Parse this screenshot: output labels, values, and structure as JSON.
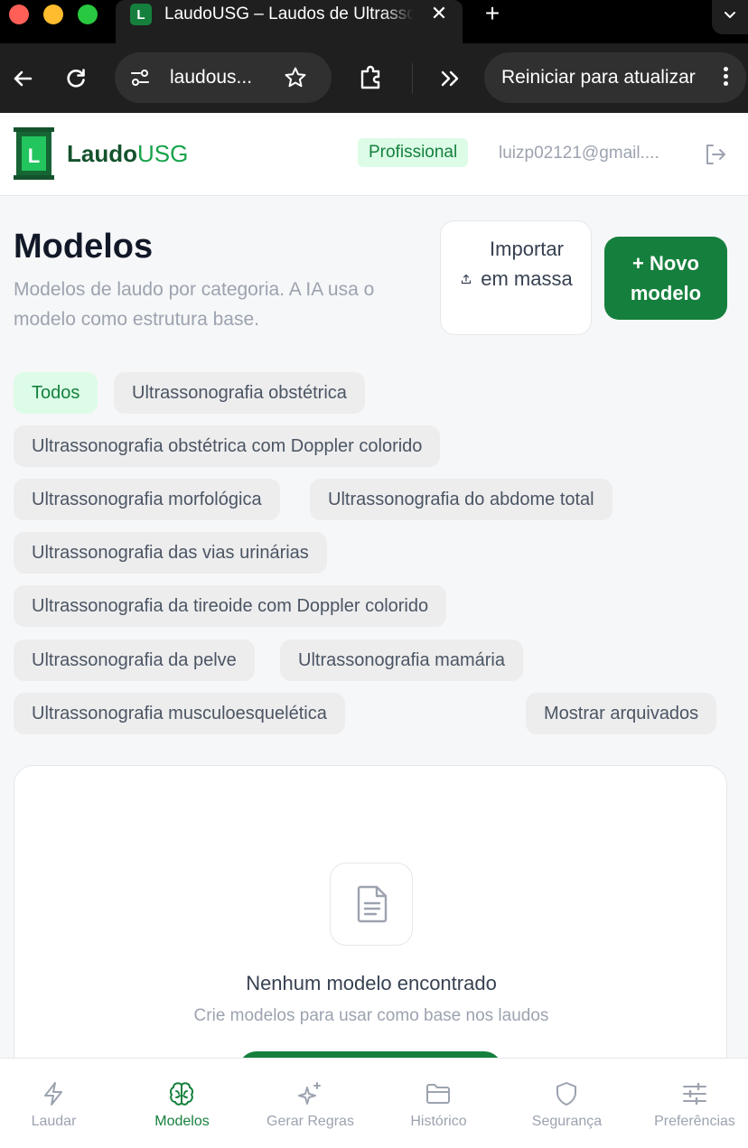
{
  "browser": {
    "tab_title": "LaudoUSG – Laudos de Ultrassonografia",
    "tab_favicon_letter": "L",
    "tab_close": "✕",
    "new_tab": "+",
    "address": "laudous...",
    "update_button": "Reiniciar para atualizar"
  },
  "header": {
    "logo_letter": "L",
    "logo_part1": "Laudo",
    "logo_part2": "USG",
    "plan_badge": "Profissional",
    "user_email": "luizp02121@gmail...."
  },
  "page": {
    "title": "Modelos",
    "subtitle": "Modelos de laudo por categoria. A IA usa o modelo como estrutura base.",
    "import_button": "Importar em massa",
    "new_button": "+ Novo modelo"
  },
  "filters": {
    "chips": [
      "Todos",
      "Ultrassonografia obstétrica",
      "Ultrassonografia obstétrica com Doppler colorido",
      "Ultrassonografia morfológica",
      "Ultrassonografia do abdome total",
      "Ultrassonografia das vias urinárias",
      "Ultrassonografia da tireoide com Doppler colorido",
      "Ultrassonografia da pelve",
      "Ultrassonografia mamária",
      "Ultrassonografia musculoesquelética"
    ],
    "active_index": 0,
    "show_archived": "Mostrar arquivados"
  },
  "empty_state": {
    "icon": "document-icon",
    "title": "Nenhum modelo encontrado",
    "subtitle": "Crie modelos para usar como base nos laudos"
  },
  "nav": {
    "items": [
      {
        "label": "Laudar",
        "icon": "lightning-icon"
      },
      {
        "label": "Modelos",
        "icon": "brain-icon"
      },
      {
        "label": "Gerar Regras",
        "icon": "sparkles-icon"
      },
      {
        "label": "Histórico",
        "icon": "folder-icon"
      },
      {
        "label": "Segurança",
        "icon": "shield-icon"
      },
      {
        "label": "Preferências",
        "icon": "sliders-icon"
      }
    ],
    "active_index": 1
  },
  "colors": {
    "brand_green": "#15803d",
    "active_chip_bg": "#dcfce7",
    "browser_dark": "#1f1f1f"
  }
}
